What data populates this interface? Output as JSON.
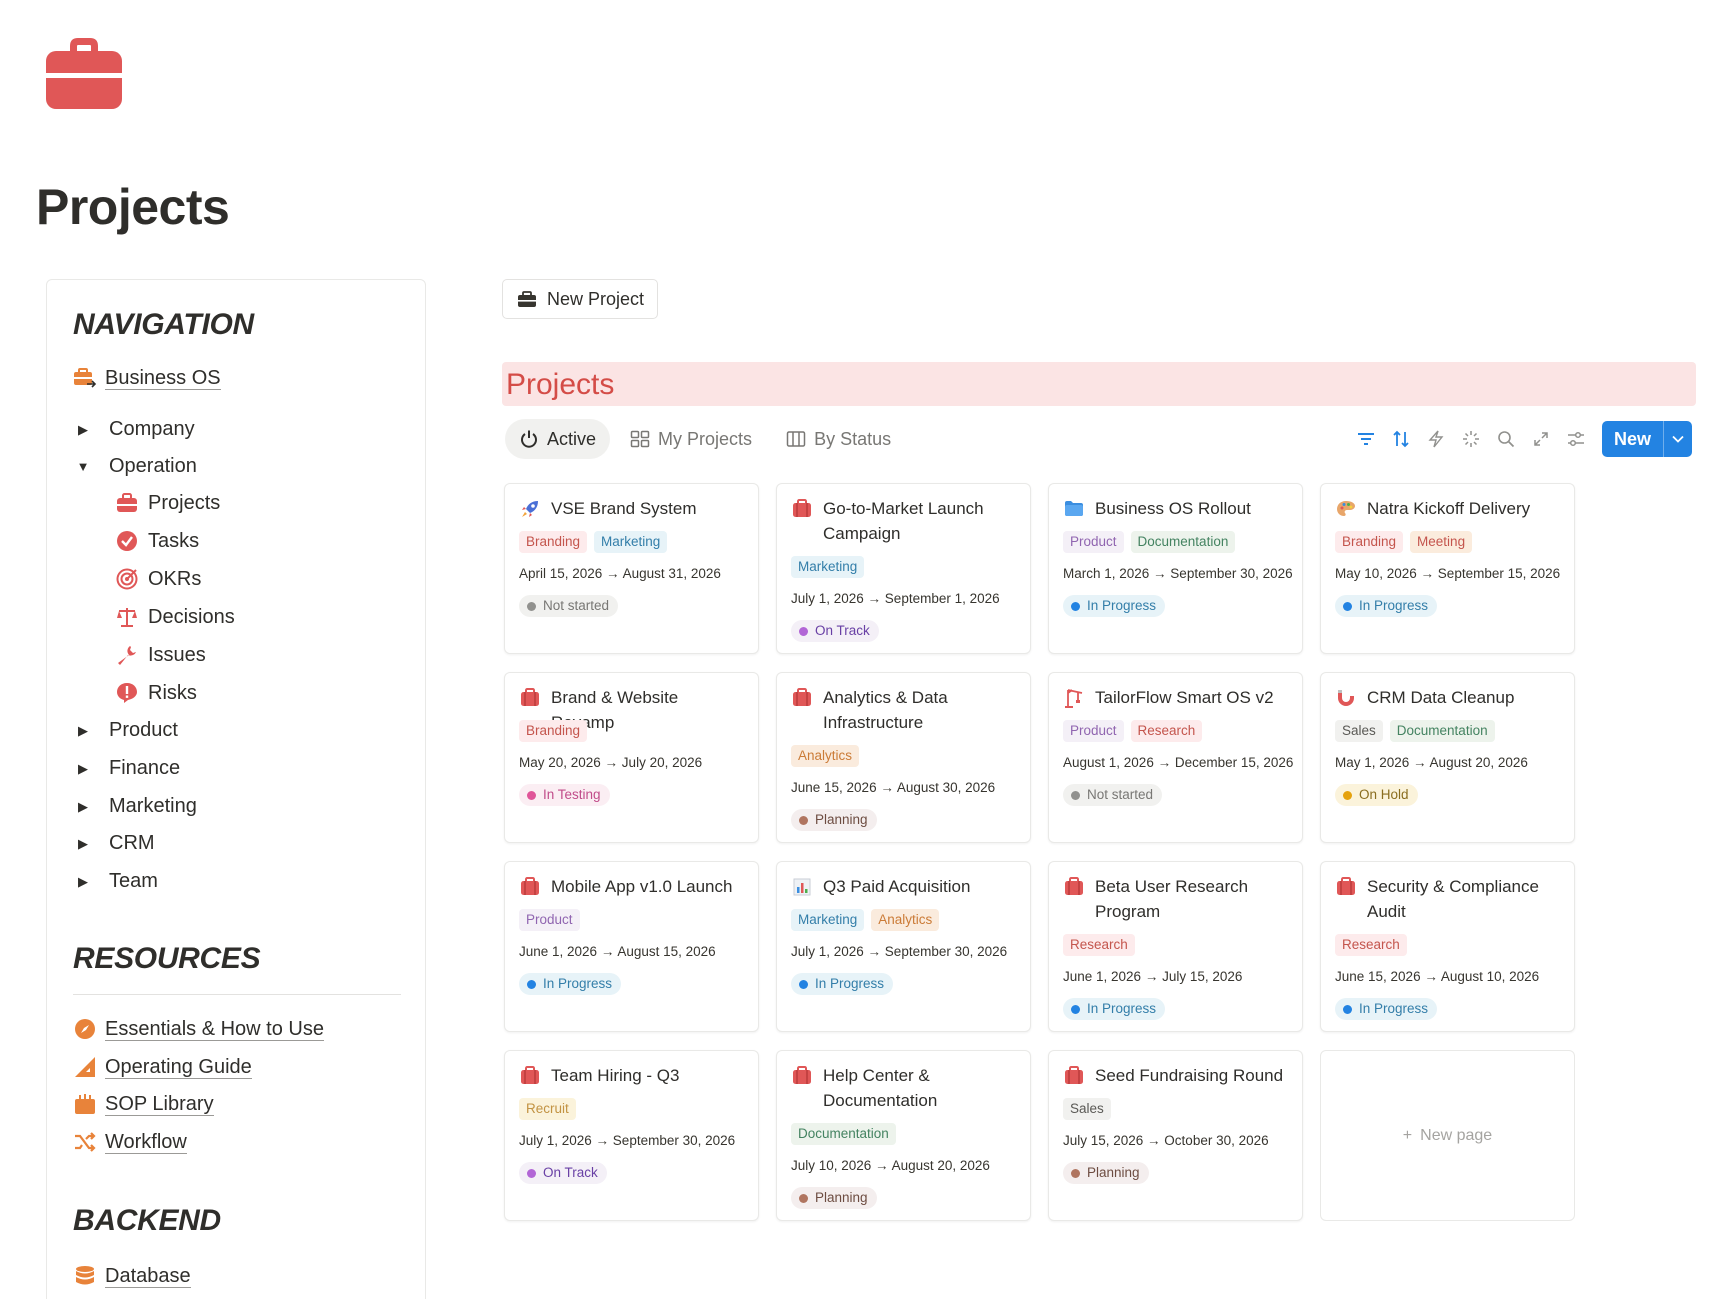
{
  "page": {
    "title": "Projects",
    "icon": "briefcase-icon"
  },
  "sidebar": {
    "navigation_heading": "NAVIGATION",
    "business_os": {
      "label": "Business OS",
      "icon": "briefcase-arrow-icon"
    },
    "company": "Company",
    "operation": "Operation",
    "operation_items": [
      {
        "label": "Projects",
        "icon": "briefcase-icon"
      },
      {
        "label": "Tasks",
        "icon": "check-circle-icon"
      },
      {
        "label": "OKRs",
        "icon": "target-icon"
      },
      {
        "label": "Decisions",
        "icon": "scales-icon"
      },
      {
        "label": "Issues",
        "icon": "wrench-icon"
      },
      {
        "label": "Risks",
        "icon": "exclamation-icon"
      }
    ],
    "product": "Product",
    "finance": "Finance",
    "marketing": "Marketing",
    "crm": "CRM",
    "team": "Team",
    "resources_heading": "RESOURCES",
    "resources": [
      {
        "label": "Essentials & How to Use",
        "icon": "compass-icon"
      },
      {
        "label": "Operating Guide",
        "icon": "ruler-triangle-icon"
      },
      {
        "label": "SOP Library",
        "icon": "archive-box-icon"
      },
      {
        "label": "Workflow",
        "icon": "shuffle-icon"
      }
    ],
    "backend_heading": "BACKEND",
    "backend": [
      {
        "label": "Database",
        "icon": "database-icon"
      }
    ]
  },
  "main": {
    "new_project_button": "New Project",
    "database_title": "Projects",
    "views": [
      {
        "label": "Active",
        "icon": "power-icon"
      },
      {
        "label": "My Projects",
        "icon": "gallery-icon"
      },
      {
        "label": "By Status",
        "icon": "board-icon"
      }
    ],
    "new_button": "New",
    "new_page": "New page"
  },
  "colors": {
    "accent": "#2383e2",
    "brand_red": "#e05757",
    "title_bar": "#fbe4e4",
    "title_text": "#d44c47"
  },
  "cards": [
    {
      "title": "VSE Brand System",
      "icon": "rocket-icon",
      "tags": [
        "Branding",
        "Marketing"
      ],
      "dates": "April 15, 2026 → August 31, 2026",
      "status": "Not started"
    },
    {
      "title": "Go-to-Market Launch Campaign",
      "icon": "briefcase-icon",
      "tags": [
        "Marketing"
      ],
      "dates": "July 1, 2026 → September 1, 2026",
      "status": "On Track"
    },
    {
      "title": "Business OS Rollout",
      "icon": "folder-icon",
      "tags": [
        "Product",
        "Documentation"
      ],
      "dates": "March 1, 2026 → September 30, 2026",
      "status": "In Progress"
    },
    {
      "title": "Natra Kickoff Delivery",
      "icon": "palette-icon",
      "tags": [
        "Branding",
        "Meeting"
      ],
      "dates": "May 10, 2026 → September 15, 2026",
      "status": "In Progress"
    },
    {
      "title": "Brand & Website Revamp",
      "icon": "briefcase-icon",
      "tags": [
        "Branding"
      ],
      "dates": "May 20, 2026 → July 20, 2026",
      "status": "In Testing"
    },
    {
      "title": "Analytics & Data Infrastructure",
      "icon": "briefcase-icon",
      "tags": [
        "Analytics"
      ],
      "dates": "June 15, 2026 → August 30, 2026",
      "status": "Planning"
    },
    {
      "title": "TailorFlow Smart OS v2",
      "icon": "crane-icon",
      "tags": [
        "Product",
        "Research"
      ],
      "dates": "August 1, 2026 → December 15, 2026",
      "status": "Not started"
    },
    {
      "title": "CRM Data Cleanup",
      "icon": "magnet-icon",
      "tags": [
        "Sales",
        "Documentation"
      ],
      "dates": "May 1, 2026 → August 20, 2026",
      "status": "On Hold"
    },
    {
      "title": "Mobile App v1.0 Launch",
      "icon": "briefcase-icon",
      "tags": [
        "Product"
      ],
      "dates": "June 1, 2026 → August 15, 2026",
      "status": "In Progress"
    },
    {
      "title": "Q3 Paid Acquisition",
      "icon": "bar-chart-icon",
      "tags": [
        "Marketing",
        "Analytics"
      ],
      "dates": "July 1, 2026 → September 30, 2026",
      "status": "In Progress"
    },
    {
      "title": "Beta User Research Program",
      "icon": "briefcase-icon",
      "tags": [
        "Research"
      ],
      "dates": "June 1, 2026 → July 15, 2026",
      "status": "In Progress"
    },
    {
      "title": "Security & Compliance Audit",
      "icon": "briefcase-icon",
      "tags": [
        "Research"
      ],
      "dates": "June 15, 2026 → August 10, 2026",
      "status": "In Progress"
    },
    {
      "title": "Team Hiring - Q3",
      "icon": "briefcase-icon",
      "tags": [
        "Recruit"
      ],
      "dates": "July 1, 2026 → September 30, 2026",
      "status": "On Track"
    },
    {
      "title": "Help Center & Documentation",
      "icon": "briefcase-icon",
      "tags": [
        "Documentation"
      ],
      "dates": "July 10, 2026 → August 20, 2026",
      "status": "Planning"
    },
    {
      "title": "Seed Fundraising Round",
      "icon": "briefcase-icon",
      "tags": [
        "Sales"
      ],
      "dates": "July 15, 2026 → October 30, 2026",
      "status": "Planning"
    }
  ]
}
